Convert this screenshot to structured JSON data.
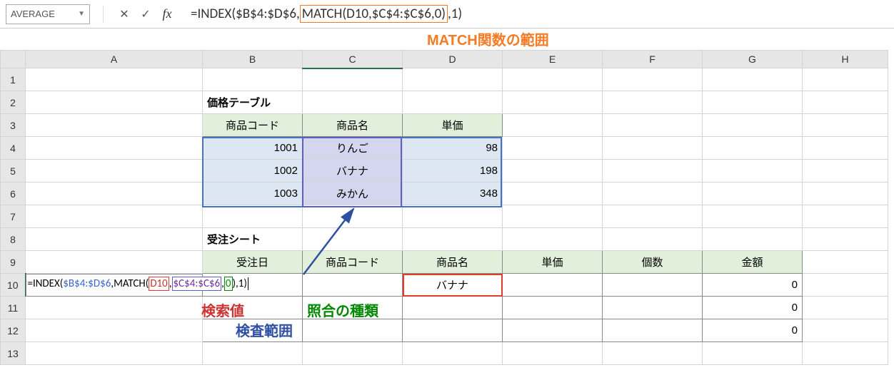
{
  "nameBox": "AVERAGE",
  "formulaBar": {
    "prefix": "=INDEX($B$4:$D$6,",
    "highlighted": "MATCH(D10,$C$4:$C$6,0)",
    "suffix": ",1)"
  },
  "annotations": {
    "top": "MATCH関数の範囲",
    "searchValue": "検索値",
    "matchType": "照合の種類",
    "lookupRange": "検査範囲"
  },
  "columns": [
    "A",
    "B",
    "C",
    "D",
    "E",
    "F",
    "G",
    "H"
  ],
  "rowNums": [
    "1",
    "2",
    "3",
    "4",
    "5",
    "6",
    "7",
    "8",
    "9",
    "10",
    "11",
    "12",
    "13"
  ],
  "priceTable": {
    "title": "価格テーブル",
    "headers": [
      "商品コード",
      "商品名",
      "単価"
    ],
    "rows": [
      {
        "code": "1001",
        "name": "りんご",
        "price": "98"
      },
      {
        "code": "1002",
        "name": "バナナ",
        "price": "198"
      },
      {
        "code": "1003",
        "name": "みかん",
        "price": "348"
      }
    ]
  },
  "orderSheet": {
    "title": "受注シート",
    "headers": [
      "受注日",
      "商品コード",
      "商品名",
      "単価",
      "個数",
      "金額"
    ],
    "row10": {
      "formulaParts": {
        "p1": "=INDEX(",
        "p2": "$B$4:$D$6",
        "p3": ",MATCH(",
        "p4": "D10",
        "p5": ",",
        "p6": "$C$4:$C$6",
        "p7": ",",
        "p8": "0",
        "p9": "),1)"
      },
      "productName": "バナナ",
      "amount": "0"
    },
    "row11": {
      "amount": "0"
    },
    "row12": {
      "amount": "0"
    }
  }
}
